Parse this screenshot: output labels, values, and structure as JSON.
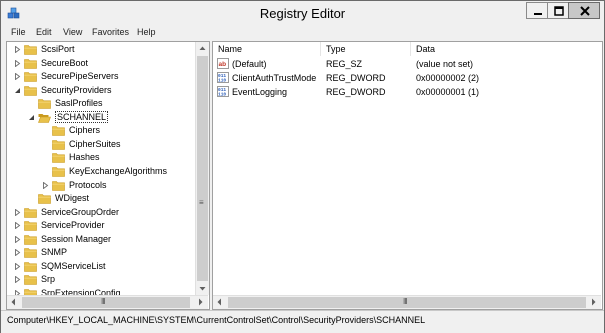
{
  "window": {
    "title": "Registry Editor"
  },
  "menu": [
    "File",
    "Edit",
    "View",
    "Favorites",
    "Help"
  ],
  "tree": {
    "items": [
      {
        "label": "ScsiPort",
        "level": 0,
        "expander": "collapsed"
      },
      {
        "label": "SecureBoot",
        "level": 0,
        "expander": "collapsed"
      },
      {
        "label": "SecurePipeServers",
        "level": 0,
        "expander": "collapsed"
      },
      {
        "label": "SecurityProviders",
        "level": 0,
        "expander": "expanded"
      },
      {
        "label": "SaslProfiles",
        "level": 1,
        "expander": "none"
      },
      {
        "label": "SCHANNEL",
        "level": 1,
        "expander": "expanded",
        "selected": true,
        "open": true
      },
      {
        "label": "Ciphers",
        "level": 2,
        "expander": "none"
      },
      {
        "label": "CipherSuites",
        "level": 2,
        "expander": "none"
      },
      {
        "label": "Hashes",
        "level": 2,
        "expander": "none"
      },
      {
        "label": "KeyExchangeAlgorithms",
        "level": 2,
        "expander": "none"
      },
      {
        "label": "Protocols",
        "level": 2,
        "expander": "collapsed"
      },
      {
        "label": "WDigest",
        "level": 1,
        "expander": "none"
      },
      {
        "label": "ServiceGroupOrder",
        "level": 0,
        "expander": "collapsed"
      },
      {
        "label": "ServiceProvider",
        "level": 0,
        "expander": "collapsed"
      },
      {
        "label": "Session Manager",
        "level": 0,
        "expander": "collapsed"
      },
      {
        "label": "SNMP",
        "level": 0,
        "expander": "collapsed"
      },
      {
        "label": "SQMServiceList",
        "level": 0,
        "expander": "collapsed"
      },
      {
        "label": "Srp",
        "level": 0,
        "expander": "collapsed"
      },
      {
        "label": "SrpExtensionConfig",
        "level": 0,
        "expander": "collapsed"
      }
    ]
  },
  "list": {
    "columns": [
      "Name",
      "Type",
      "Data"
    ],
    "rows": [
      {
        "name": "(Default)",
        "type": "REG_SZ",
        "data": "(value not set)",
        "icon": "string-value-icon"
      },
      {
        "name": "ClientAuthTrustMode",
        "type": "REG_DWORD",
        "data": "0x00000002 (2)",
        "icon": "binary-value-icon"
      },
      {
        "name": "EventLogging",
        "type": "REG_DWORD",
        "data": "0x00000001 (1)",
        "icon": "binary-value-icon"
      }
    ]
  },
  "status": {
    "path": "Computer\\HKEY_LOCAL_MACHINE\\SYSTEM\\CurrentControlSet\\Control\\SecurityProviders\\SCHANNEL"
  },
  "colors": {
    "folder": "#e8c14a",
    "folderDark": "#c99a1e",
    "stringIcon": "#c0392b",
    "binaryIcon": "#2b5cb8"
  }
}
